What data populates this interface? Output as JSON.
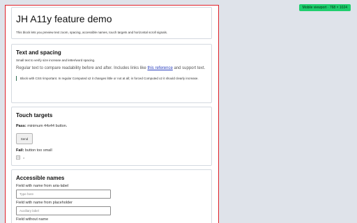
{
  "badge": "Mobile viewport · 768 × 1024",
  "header": {
    "title": "JH A11y feature demo",
    "subtitle": "This block lets you preview text zoom, spacing, accessible names, touch targets and horizontal scroll signals."
  },
  "text_spacing": {
    "heading": "Text and spacing",
    "small_text": "Small text to verify size increase and letter/word spacing.",
    "regular_before": "Regular text to compare readability before and after. Includes links like ",
    "link_text": "this reference",
    "regular_after": " and support text.",
    "important_text": "Block with CSS !important. In regular Computed x2 it changes little or not at all; in forced Computed x2 it should clearly increase."
  },
  "touch_targets": {
    "heading": "Touch targets",
    "pass_label": "Pass:",
    "pass_text": " minimum 44x44 button.",
    "send_label": "Send",
    "fail_label": "Fail:",
    "fail_text": " button too small",
    "tiny_button_label": "□",
    "tiny_x_label": "×"
  },
  "accessible_names": {
    "heading": "Accessible names",
    "field1_label": "Field with name from aria-label",
    "field1_placeholder": "Type here",
    "field2_label": "Field with name from placeholder",
    "field2_placeholder": "Auxiliary label",
    "field3_label": "Field without name"
  }
}
